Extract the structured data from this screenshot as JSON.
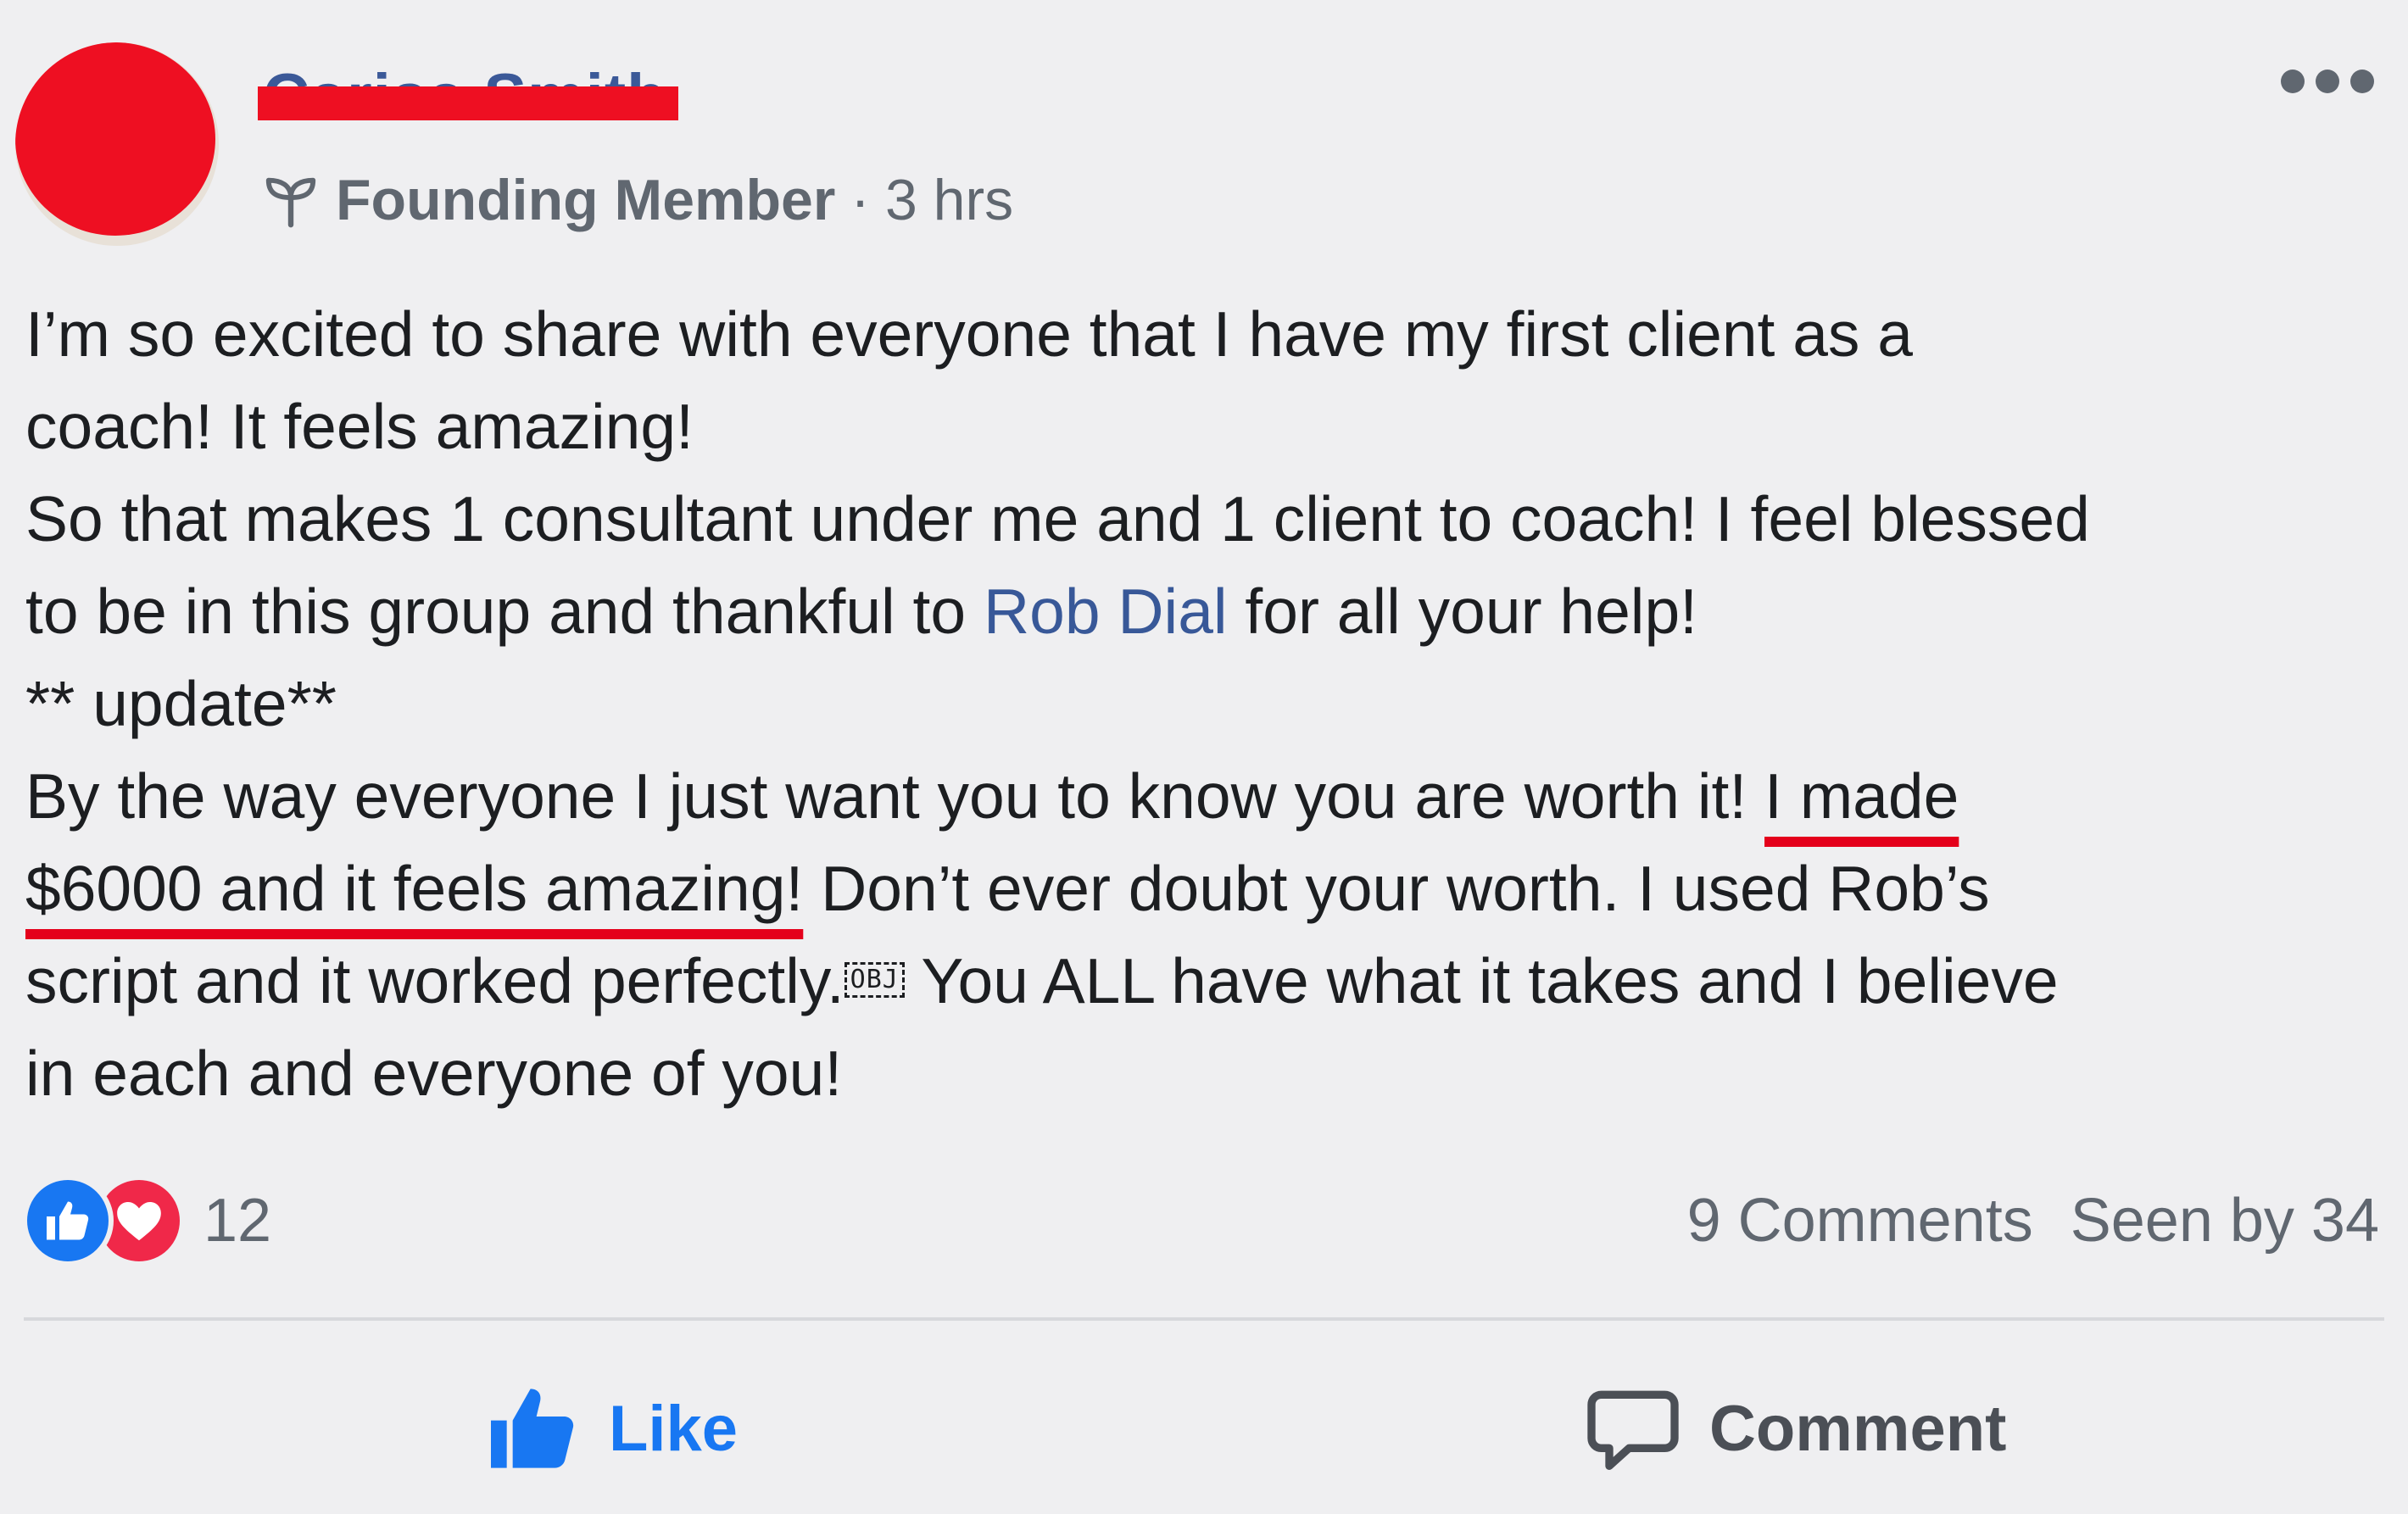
{
  "post": {
    "author": {
      "name": "Carisa Smith",
      "badge": "Founding Member",
      "separator": "·",
      "time": "3 hrs"
    },
    "more_icon": "more-dots-icon",
    "body": {
      "l1": "I’m so excited to share with everyone that I have my first client as a",
      "l2": "coach! It feels amazing!",
      "l3": "So that makes 1 consultant under me and 1 client to coach! I feel blessed",
      "l4a": "to be in this group and thankful to ",
      "mention": "Rob Dial",
      "l4b": " for all your help!",
      "l5": "** update**",
      "l6a": "By the way everyone I just want you to know you are worth it! ",
      "hl1": "I made",
      "hl2": "$6000 and it feels amazing!",
      "l7b": " Don’t ever doubt your worth. I used Rob’s",
      "l8a": "script and it worked perfectly.",
      "obj": "OBJ",
      "l8b": " You ALL have what it takes and I believe",
      "l9": "in each and everyone of you!"
    },
    "reactions": {
      "icons": [
        "like-reaction-icon",
        "love-reaction-icon"
      ],
      "count": "12"
    },
    "stats": {
      "comments": "9 Comments",
      "seen": "Seen by 34"
    },
    "actions": {
      "like": "Like",
      "comment": "Comment"
    },
    "colors": {
      "background": "#efeff1",
      "link": "#385898",
      "like_blue": "#1877f2",
      "love_red": "#f02849",
      "redaction_red": "#ee0f22",
      "highlight_underline": "#e4001b",
      "meta_gray": "#606770"
    }
  }
}
